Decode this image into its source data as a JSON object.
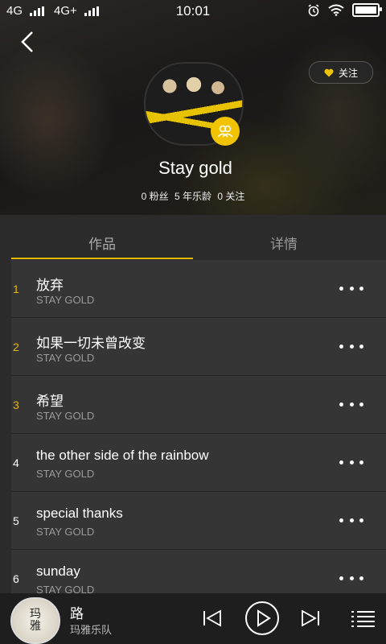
{
  "status_bar": {
    "network1": "4G",
    "network2": "4G+",
    "time": "10:01"
  },
  "header": {
    "follow_label": "关注",
    "artist_name": "Stay gold",
    "stats": {
      "fans": "0 粉丝",
      "years": "5 年乐龄",
      "following": "0 关注"
    }
  },
  "tabs": [
    {
      "label": "作品"
    },
    {
      "label": "详情"
    }
  ],
  "colors": {
    "accent": "#e6b800",
    "background": "#2b2b2b",
    "row": "#353535",
    "player": "#1e1e1e"
  },
  "songs": [
    {
      "num": "1",
      "title": "放弃",
      "artist": "STAY GOLD",
      "num_color": "#e6b800"
    },
    {
      "num": "2",
      "title": "如果一切未曾改变",
      "artist": "STAY GOLD",
      "num_color": "#e6b800"
    },
    {
      "num": "3",
      "title": "希望",
      "artist": "STAY GOLD",
      "num_color": "#e6b800"
    },
    {
      "num": "4",
      "title": "the other side of the rainbow",
      "artist": "STAY GOLD",
      "num_color": "#ffffff"
    },
    {
      "num": "5",
      "title": "special thanks",
      "artist": "STAY GOLD",
      "num_color": "#ffffff"
    },
    {
      "num": "6",
      "title": "sunday",
      "artist": "STAY GOLD",
      "num_color": "#ffffff"
    }
  ],
  "player": {
    "cover_text": "玛雅",
    "title": "路",
    "artist": "玛雅乐队",
    "icons": [
      "previous-icon",
      "play-icon",
      "next-icon",
      "playlist-icon"
    ]
  }
}
